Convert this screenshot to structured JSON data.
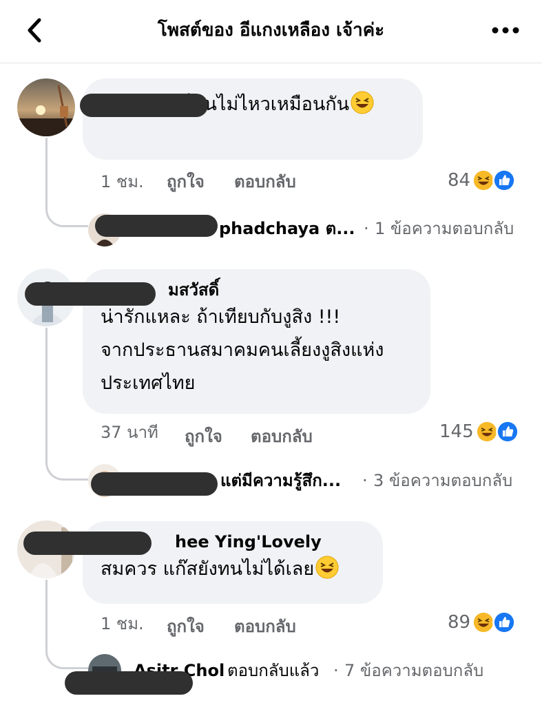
{
  "header": {
    "title": "โพสต์ของ อีแกงเหลือง เจ้าค่ะ"
  },
  "comments": [
    {
      "author": "",
      "text": "แก๊สบอกกูก็ทนไม่ไหวเหมือนกัน",
      "time": "1 ชม.",
      "like": "ถูกใจ",
      "reply": "ตอบกลับ",
      "reactions": "84",
      "reply_preview": {
        "name": "phadchaya ต...",
        "sep": "·",
        "count": "1 ข้อความตอบกลับ"
      }
    },
    {
      "author": "มสวัสดิ์",
      "text_lines": [
        "น่ารักแหละ ถ้าเทียบกับงูสิง !!!",
        "จากประธานสมาคมคนเลี้ยงงูสิงแห่ง",
        "ประเทศไทย"
      ],
      "time": "37 นาที",
      "like": "ถูกใจ",
      "reply": "ตอบกลับ",
      "reactions": "145",
      "reply_preview": {
        "name": "แต่มีความรู้สึก...",
        "sep": "·",
        "count": "3 ข้อความตอบกลับ"
      }
    },
    {
      "author": "hee Ying'Lovely",
      "text": "สมควร แก๊สยังทนไม่ได้เลย",
      "time": "1 ชม.",
      "like": "ถูกใจ",
      "reply": "ตอบกลับ",
      "reactions": "89",
      "reply_preview": {
        "name": "Asitr Chol",
        "action": "ตอบกลับแล้ว",
        "sep": "·",
        "count": "7 ข้อความตอบกลับ"
      }
    }
  ],
  "colors": {
    "like_blue": "#1877f2",
    "haha_yellow": "#f7b928",
    "meta_gray": "#65676b",
    "bubble": "#f0f2f5"
  },
  "icons": [
    "back-chevron-icon",
    "more-dots-icon",
    "laugh-emoji-icon",
    "like-reaction-icon",
    "haha-reaction-icon"
  ]
}
